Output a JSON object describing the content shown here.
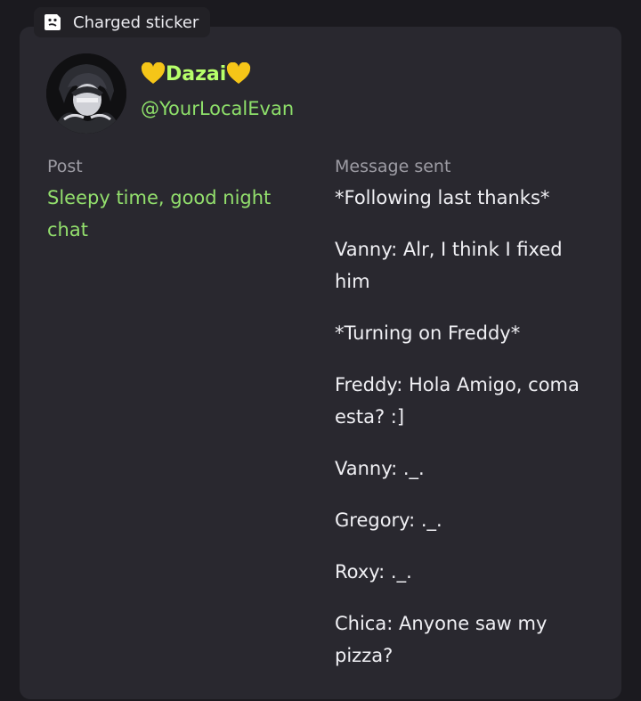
{
  "sticker": {
    "label": "Charged sticker",
    "icon": "sticker-icon"
  },
  "profile": {
    "display_name": "Dazai",
    "name_decoration": "yellow-heart-icon",
    "handle": "@YourLocalEvan"
  },
  "post": {
    "label": "Post",
    "text": "Sleepy time, good night chat"
  },
  "message": {
    "label": "Message sent",
    "lines": [
      "*Following last thanks*",
      "Vanny: Alr, I think I fixed him",
      "*Turning on Freddy*",
      "Freddy: Hola Amigo, coma esta? :]",
      "Vanny: ._.",
      "Gregory: ._.",
      "Roxy: ._.",
      "Chica: Anyone saw my pizza?"
    ]
  },
  "colors": {
    "background": "#1b1a1f",
    "card": "#29282f",
    "name_accent": "#b7ff6a",
    "handle_accent": "#8ee06a",
    "post_text": "#93e06d",
    "heart": "#f5c518"
  }
}
